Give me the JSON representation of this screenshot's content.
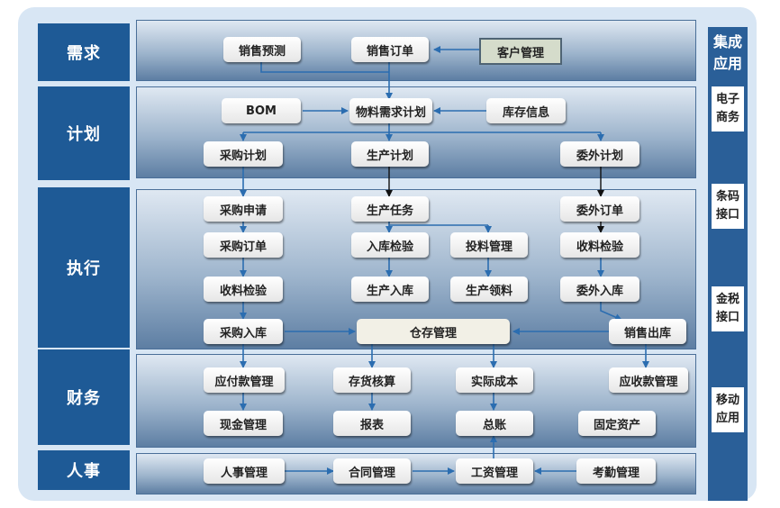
{
  "sections": {
    "demand": "需求",
    "plan": "计划",
    "execute": "执行",
    "finance": "财务",
    "hr": "人事"
  },
  "integration": {
    "title": "集成应用",
    "items": [
      "电子商务",
      "条码接口",
      "金税接口",
      "移动应用"
    ]
  },
  "demand": {
    "sales_forecast": "销售预测",
    "sales_order": "销售订单",
    "customer_mgmt": "客户管理"
  },
  "plan": {
    "bom": "BOM",
    "mrp": "物料需求计划",
    "inventory_info": "库存信息",
    "purchase_plan": "采购计划",
    "production_plan": "生产计划",
    "outsource_plan": "委外计划"
  },
  "execute": {
    "purchase_request": "采购申请",
    "production_task": "生产任务",
    "outsource_order": "委外订单",
    "purchase_order": "采购订单",
    "inbound_inspection": "入库检验",
    "material_feed": "投料管理",
    "receipt_inspection": "收料检验",
    "purchase_receipt_inspection": "收料检验",
    "production_inbound": "生产入库",
    "production_picking": "生产领料",
    "outsource_inbound": "委外入库",
    "purchase_inbound": "采购入库",
    "warehouse_mgmt": "仓存管理",
    "sales_outbound": "销售出库"
  },
  "finance": {
    "payables": "应付款管理",
    "inventory_accounting": "存货核算",
    "actual_cost": "实际成本",
    "receivables": "应收款管理",
    "cash_mgmt": "现金管理",
    "reports": "报表",
    "general_ledger": "总账",
    "fixed_assets": "固定资产"
  },
  "hr": {
    "personnel": "人事管理",
    "contract": "合同管理",
    "payroll": "工资管理",
    "attendance": "考勤管理"
  }
}
